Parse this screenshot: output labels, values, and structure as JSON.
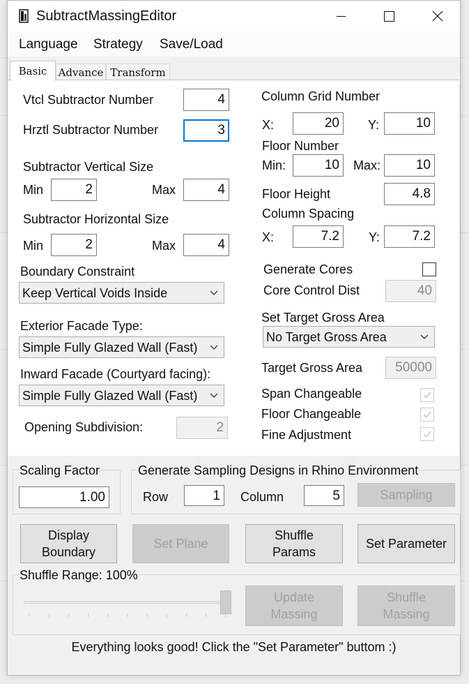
{
  "window": {
    "title": "SubtractMassingEditor",
    "icon": "app-icon",
    "controls": [
      "minimize-icon",
      "maximize-icon",
      "close-icon"
    ]
  },
  "menu": {
    "language": "Language",
    "strategy": "Strategy",
    "save_load": "Save/Load"
  },
  "tabs": {
    "basic": "Basic",
    "advance": "Advance",
    "transform": "Transform",
    "active": "Basic"
  },
  "basic": {
    "vtcl_label": "Vtcl  Subtractor Number",
    "vtcl_value": "4",
    "hrztl_label": "Hrztl Subtractor Number",
    "hrztl_value": "3",
    "vsize_label": "Subtractor Vertical Size",
    "vsize_min_label": "Min",
    "vsize_min": "2",
    "vsize_max_label": "Max",
    "vsize_max": "4",
    "hsize_label": "Subtractor Horizontal Size",
    "hsize_min_label": "Min",
    "hsize_min": "2",
    "hsize_max_label": "Max",
    "hsize_max": "4",
    "boundary_label": "Boundary Constraint",
    "boundary_value": "Keep Vertical Voids Inside",
    "exterior_label": "Exterior Facade Type:",
    "exterior_value": "Simple Fully Glazed Wall (Fast)",
    "inward_label": "Inward Facade (Courtyard facing):",
    "inward_value": "Simple Fully Glazed Wall (Fast)",
    "opening_label": "Opening Subdivision:",
    "opening_value": "2",
    "grid_label": "Column Grid Number",
    "grid_x_label": "X:",
    "grid_x": "20",
    "grid_y_label": "Y:",
    "grid_y": "10",
    "floor_num_label": "Floor Number",
    "floor_min_label": "Min:",
    "floor_min": "10",
    "floor_max_label": "Max:",
    "floor_max": "10",
    "floor_height_label": "Floor Height",
    "floor_height": "4.8",
    "spacing_label": "Column Spacing",
    "spacing_x_label": "X:",
    "spacing_x": "7.2",
    "spacing_y_label": "Y:",
    "spacing_y": "7.2",
    "cores_label": "Generate Cores",
    "cores_checked": false,
    "core_dist_label": "Core Control Dist",
    "core_dist": "40",
    "target_set_label": "Set Target Gross Area",
    "target_set_value": "No Target Gross Area",
    "target_area_label": "Target Gross Area",
    "target_area": "50000",
    "span_label": "Span Changeable",
    "span_checked": true,
    "floor_change_label": "Floor Changeable",
    "floor_change_checked": true,
    "fine_label": "Fine Adjustment",
    "fine_checked": true
  },
  "scaling": {
    "label": "Scaling Factor",
    "value": "1.00"
  },
  "sampling": {
    "label": "Generate Sampling Designs in Rhino Environment",
    "row_label": "Row",
    "row": "1",
    "column_label": "Column",
    "column": "5",
    "button": "Sampling"
  },
  "buttons": {
    "display_boundary_1": "Display",
    "display_boundary_2": "Boundary",
    "set_plane": "Set Plane",
    "shuffle_params_1": "Shuffle",
    "shuffle_params_2": "Params",
    "set_parameter": "Set Parameter",
    "update_massing_1": "Update",
    "update_massing_2": "Massing",
    "shuffle_massing_1": "Shuffle",
    "shuffle_massing_2": "Massing"
  },
  "shuffle_range": {
    "label": "Shuffle Range: 100%",
    "value": 1.0
  },
  "status": {
    "message": "Everything looks good! Click the \"Set Parameter\" buttom :)"
  }
}
